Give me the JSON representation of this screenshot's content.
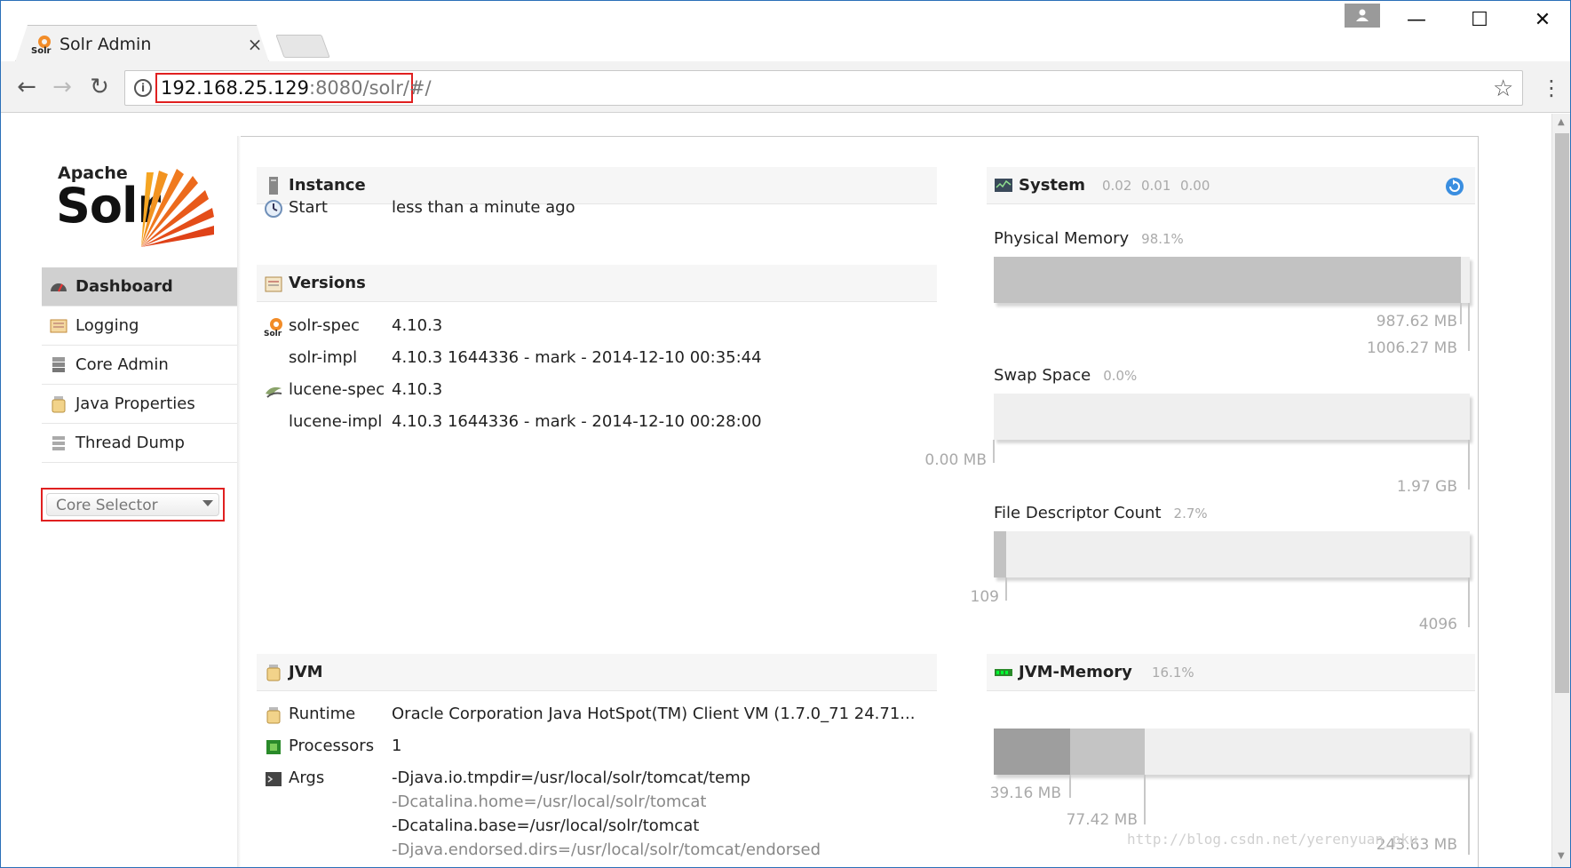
{
  "browser": {
    "tab_title": "Solr Admin",
    "tab_close": "×",
    "url_host": "192.168.25.129",
    "url_rest": ":8080/solr/#/",
    "window_controls": {
      "minimize": "—",
      "maximize": "☐",
      "close": "✕"
    }
  },
  "logo": {
    "apache": "Apache",
    "solr": "Solr"
  },
  "nav": {
    "items": [
      {
        "label": "Dashboard",
        "active": true,
        "icon": "dashboard-icon"
      },
      {
        "label": "Logging",
        "icon": "logging-icon"
      },
      {
        "label": "Core Admin",
        "icon": "core-admin-icon"
      },
      {
        "label": "Java Properties",
        "icon": "java-properties-icon"
      },
      {
        "label": "Thread Dump",
        "icon": "thread-dump-icon"
      }
    ],
    "core_selector": "Core Selector"
  },
  "instance": {
    "title": "Instance",
    "start_label": "Start",
    "start_value": "less than a minute ago"
  },
  "versions": {
    "title": "Versions",
    "rows": [
      {
        "key": "solr-spec",
        "value": "4.10.3"
      },
      {
        "key": "solr-impl",
        "value": "4.10.3 1644336 - mark - 2014-12-10 00:35:44"
      },
      {
        "key": "lucene-spec",
        "value": "4.10.3"
      },
      {
        "key": "lucene-impl",
        "value": "4.10.3 1644336 - mark - 2014-12-10 00:28:00"
      }
    ]
  },
  "jvm": {
    "title": "JVM",
    "runtime_label": "Runtime",
    "runtime_value": "Oracle Corporation Java HotSpot(TM) Client VM (1.7.0_71 24.71...",
    "processors_label": "Processors",
    "processors_value": "1",
    "args_label": "Args",
    "args": [
      "-Djava.io.tmpdir=/usr/local/solr/tomcat/temp",
      "-Dcatalina.home=/usr/local/solr/tomcat",
      "-Dcatalina.base=/usr/local/solr/tomcat",
      "-Djava.endorsed.dirs=/usr/local/solr/tomcat/endorsed"
    ]
  },
  "system": {
    "title": "System",
    "load": [
      "0.02",
      "0.01",
      "0.00"
    ],
    "physical_memory": {
      "label": "Physical Memory",
      "pct": "98.1%",
      "used": "987.62 MB",
      "total": "1006.27 MB",
      "fraction": 0.981
    },
    "swap_space": {
      "label": "Swap Space",
      "pct": "0.0%",
      "used": "0.00 MB",
      "total": "1.97 GB",
      "fraction": 0.0
    },
    "file_descriptors": {
      "label": "File Descriptor Count",
      "pct": "2.7%",
      "used": "109",
      "total": "4096",
      "fraction": 0.027
    }
  },
  "jvm_memory": {
    "title": "JVM-Memory",
    "pct": "16.1%",
    "used": "39.16 MB",
    "committed": "77.42 MB",
    "max": "243.63 MB",
    "used_fraction": 0.161,
    "committed_fraction": 0.318
  },
  "watermark": "http://blog.csdn.net/yerenyuan_pku",
  "colors": {
    "accent_red": "#e02020",
    "bar_fill": "#c2c2c2",
    "bar_track": "#efefef"
  }
}
